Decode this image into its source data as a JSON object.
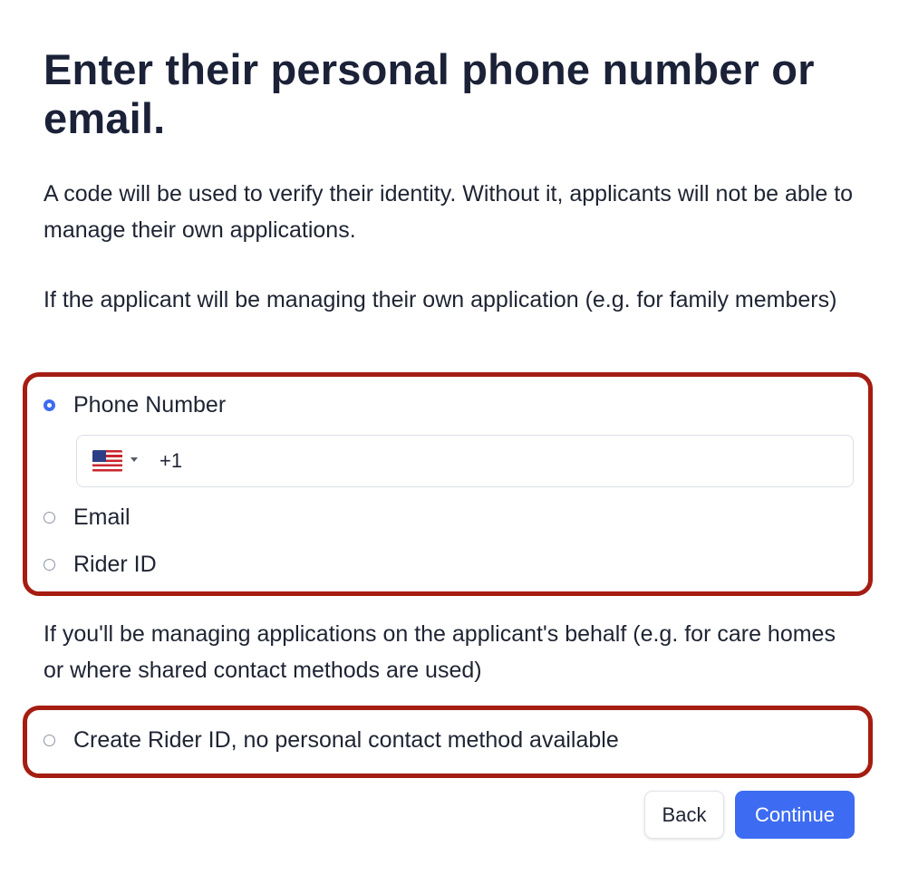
{
  "page": {
    "title": "Enter their personal phone number or email.",
    "intro": "A code will be used to verify their identity. Without it, applicants will not be able to manage their own applications.",
    "self_managed_hint": "If the applicant will be managing their own application (e.g. for family members)",
    "agent_managed_hint": "If you'll be managing applications on the applicant's behalf (e.g. for care homes or where shared contact methods are used)"
  },
  "contact_options": [
    {
      "label": "Phone Number",
      "selected": true
    },
    {
      "label": "Email",
      "selected": false
    },
    {
      "label": "Rider ID",
      "selected": false
    }
  ],
  "phone_field": {
    "country_flag_icon": "us-flag-icon",
    "country_code": "+1",
    "value": ""
  },
  "agent_option": {
    "label": "Create Rider ID, no personal contact method available",
    "selected": false
  },
  "actions": {
    "back_label": "Back",
    "continue_label": "Continue"
  },
  "colors": {
    "accent": "#3d6cf2",
    "highlight_border": "#a51d12",
    "text": "#1b2238"
  }
}
